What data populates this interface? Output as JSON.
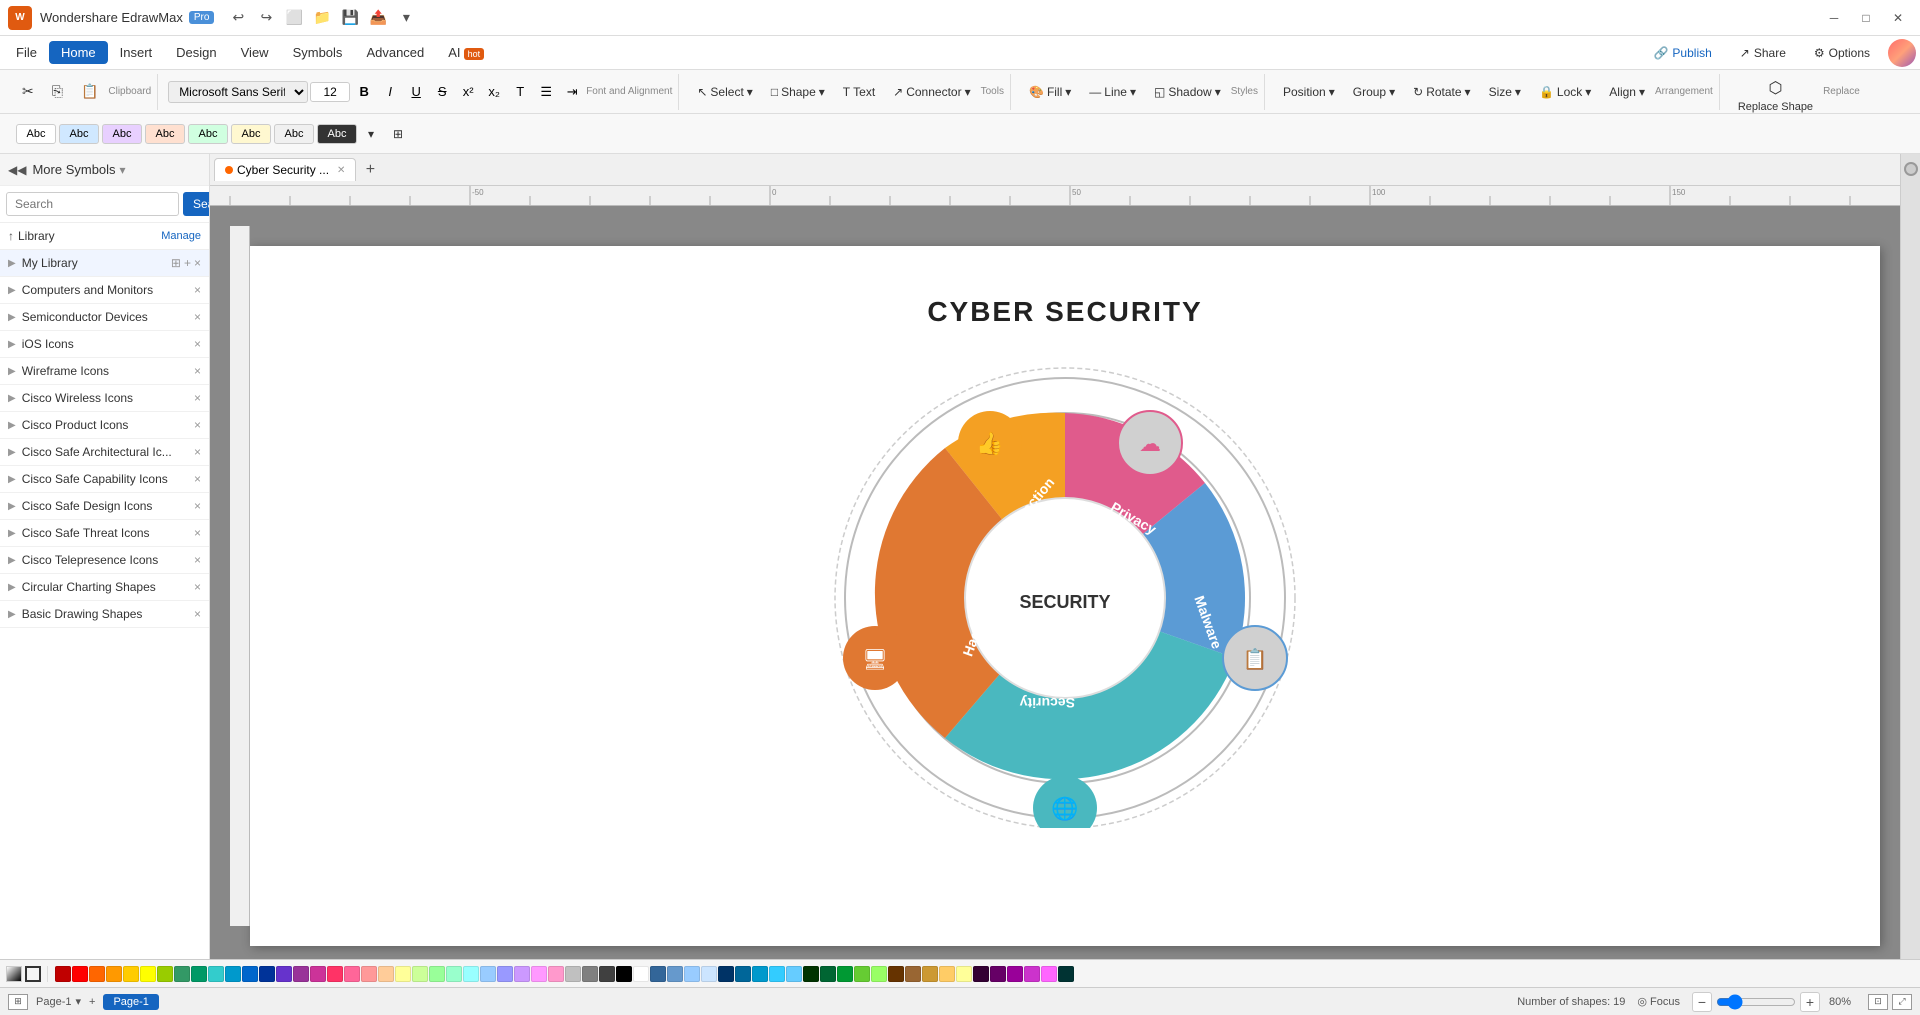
{
  "titleBar": {
    "appName": "Wondershare EdrawMax",
    "proBadge": "Pro",
    "quickAccess": [
      "↩",
      "↪",
      "⬜",
      "📁",
      "💾",
      "📤",
      "⬇",
      "▾"
    ]
  },
  "menuBar": {
    "items": [
      "File",
      "Home",
      "Insert",
      "Design",
      "View",
      "Symbols",
      "Advanced"
    ],
    "activeItem": "Home",
    "aiLabel": "AI",
    "aiBadge": "hot",
    "rightActions": {
      "publish": "Publish",
      "share": "Share",
      "options": "Options"
    }
  },
  "toolbar1": {
    "clipboard": [
      "✂",
      "📋",
      "⎘"
    ],
    "font": "Microsoft Sans Serif",
    "fontSize": "12",
    "selectLabel": "Select",
    "shapeLabel": "Shape",
    "textLabel": "Text",
    "connectorLabel": "Connector",
    "fill": "Fill",
    "line": "Line",
    "shadow": "Shadow",
    "position": "Position",
    "group": "Group",
    "rotate": "Rotate",
    "size": "Size",
    "lock": "Lock",
    "align": "Align",
    "replaceShape": "Replace Shape",
    "replace": "Replace"
  },
  "toolbar2": {
    "styles": [
      "Abc",
      "Abc",
      "Abc",
      "Abc",
      "Abc",
      "Abc",
      "Abc",
      "Abc"
    ]
  },
  "tab": {
    "name": "Cyber Security ...",
    "modified": true
  },
  "sidebar": {
    "title": "More Symbols",
    "searchPlaceholder": "Search",
    "searchBtn": "Search",
    "libraryLabel": "Library",
    "manageLabel": "Manage",
    "categories": [
      {
        "name": "My Library",
        "icons": [
          "⊞",
          "+",
          "×"
        ],
        "isMyLib": true
      },
      {
        "name": "Computers and Monitors",
        "icons": [
          "×"
        ]
      },
      {
        "name": "Semiconductor Devices",
        "icons": [
          "×"
        ]
      },
      {
        "name": "iOS Icons",
        "icons": [
          "×"
        ]
      },
      {
        "name": "Wireframe Icons",
        "icons": [
          "×"
        ]
      },
      {
        "name": "Cisco Wireless Icons",
        "icons": [
          "×"
        ]
      },
      {
        "name": "Cisco Product Icons",
        "icons": [
          "×"
        ]
      },
      {
        "name": "Cisco Safe Architectural Ic...",
        "icons": [
          "×"
        ]
      },
      {
        "name": "Cisco Safe Capability Icons",
        "icons": [
          "×"
        ]
      },
      {
        "name": "Cisco Safe Design Icons",
        "icons": [
          "×"
        ]
      },
      {
        "name": "Cisco Safe Threat Icons",
        "icons": [
          "×"
        ]
      },
      {
        "name": "Cisco Telepresence Icons",
        "icons": [
          "×"
        ]
      },
      {
        "name": "Circular Charting Shapes",
        "icons": [
          "×"
        ]
      },
      {
        "name": "Basic Drawing Shapes",
        "icons": [
          "×"
        ]
      }
    ]
  },
  "canvas": {
    "diagramTitle": "CYBER SECURITY",
    "centerLabel": "SECURITY",
    "segments": [
      {
        "label": "Protection",
        "color": "#F4A023"
      },
      {
        "label": "Privacy",
        "color": "#E05B8C"
      },
      {
        "label": "Malware",
        "color": "#5B9BD5"
      },
      {
        "label": "Security",
        "color": "#4AB8BF"
      },
      {
        "label": "Hacker",
        "color": "#E07832"
      }
    ]
  },
  "statusBar": {
    "pageLabel": "Page-1",
    "addPage": "+",
    "shapesCount": "Number of shapes: 19",
    "focusLabel": "Focus",
    "zoomLevel": "80%",
    "pageTabLabel": "Page-1"
  },
  "colors": [
    "#C00000",
    "#FF0000",
    "#FF6600",
    "#FF9900",
    "#FFCC00",
    "#FFFF00",
    "#99CC00",
    "#339966",
    "#009966",
    "#33CCCC",
    "#0099CC",
    "#0066CC",
    "#003399",
    "#6633CC",
    "#993399",
    "#CC3399",
    "#FF3366",
    "#FF6699",
    "#FF9999",
    "#FFCC99",
    "#FFFF99",
    "#CCFF99",
    "#99FF99",
    "#99FFCC",
    "#99FFFF",
    "#99CCFF",
    "#9999FF",
    "#CC99FF",
    "#FF99FF",
    "#FF99CC",
    "#C0C0C0",
    "#808080",
    "#404040",
    "#000000",
    "#FFFFFF",
    "#336699",
    "#6699CC",
    "#99CCFF",
    "#CCE5FF",
    "#003366",
    "#006699",
    "#0099CC",
    "#33CCFF",
    "#66CCFF",
    "#003300",
    "#006633",
    "#009933",
    "#66CC33",
    "#99FF66",
    "#663300",
    "#996633",
    "#CC9933",
    "#FFCC66",
    "#FFFF99",
    "#330033",
    "#660066",
    "#990099",
    "#CC33CC",
    "#FF66FF",
    "#003333"
  ],
  "replaceShape": {
    "label": "Replace Shape"
  }
}
